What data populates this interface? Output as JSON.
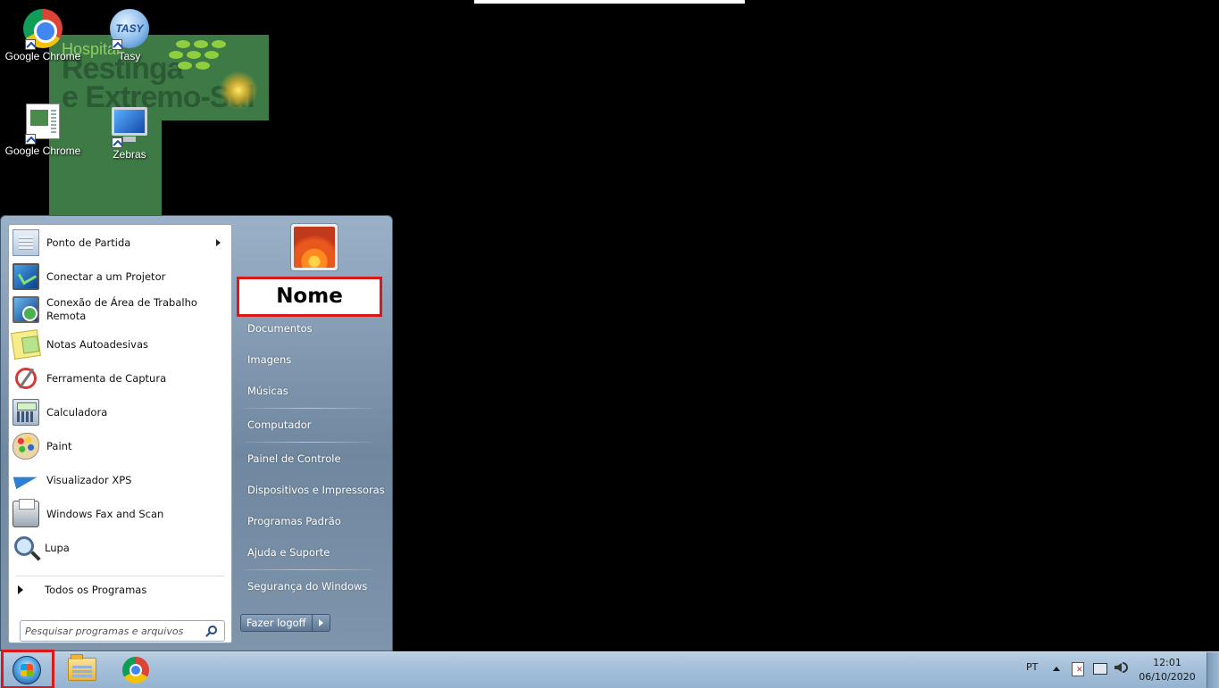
{
  "wallpaper": {
    "logo_line1": "Hospital",
    "logo_line2": "Restinga",
    "logo_line3": "e Extremo-Sul"
  },
  "desktop_icons": [
    {
      "label": "Google Chrome",
      "icon": "chrome-icon"
    },
    {
      "label": "Tasy",
      "icon": "tasy-icon",
      "badge": "TASY"
    },
    {
      "label": "Google Chrome",
      "icon": "document-shortcut-icon"
    },
    {
      "label": "Zebras",
      "icon": "monitor-icon"
    }
  ],
  "start_menu": {
    "programs": [
      {
        "label": "Ponto de Partida",
        "icon": "getting-started-icon",
        "has_submenu": true
      },
      {
        "label": "Conectar a um Projetor",
        "icon": "projector-icon"
      },
      {
        "label": "Conexão de Área de Trabalho Remota",
        "icon": "remote-desktop-icon"
      },
      {
        "label": "Notas Autoadesivas",
        "icon": "sticky-notes-icon"
      },
      {
        "label": "Ferramenta de Captura",
        "icon": "snipping-tool-icon"
      },
      {
        "label": "Calculadora",
        "icon": "calculator-icon"
      },
      {
        "label": "Paint",
        "icon": "paint-icon"
      },
      {
        "label": "Visualizador XPS",
        "icon": "xps-viewer-icon"
      },
      {
        "label": "Windows Fax and Scan",
        "icon": "fax-scan-icon"
      },
      {
        "label": "Lupa",
        "icon": "magnifier-icon"
      }
    ],
    "all_programs": "Todos os Programas",
    "search_placeholder": "Pesquisar programas e arquivos",
    "user_name": "Nome",
    "right_links": [
      "Documentos",
      "Imagens",
      "Músicas",
      "Computador",
      "Painel de Controle",
      "Dispositivos e Impressoras",
      "Programas Padrão",
      "Ajuda e Suporte",
      "Segurança do Windows"
    ],
    "logoff_label": "Fazer logoff"
  },
  "taskbar": {
    "pinned": [
      "windows-explorer-icon",
      "chrome-icon"
    ],
    "language": "PT",
    "time": "12:01",
    "date": "06/10/2020"
  },
  "colors": {
    "highlight_red": "#d81919",
    "taskbar": "#a4bfd9",
    "start_menu_right": "#6f879f"
  }
}
